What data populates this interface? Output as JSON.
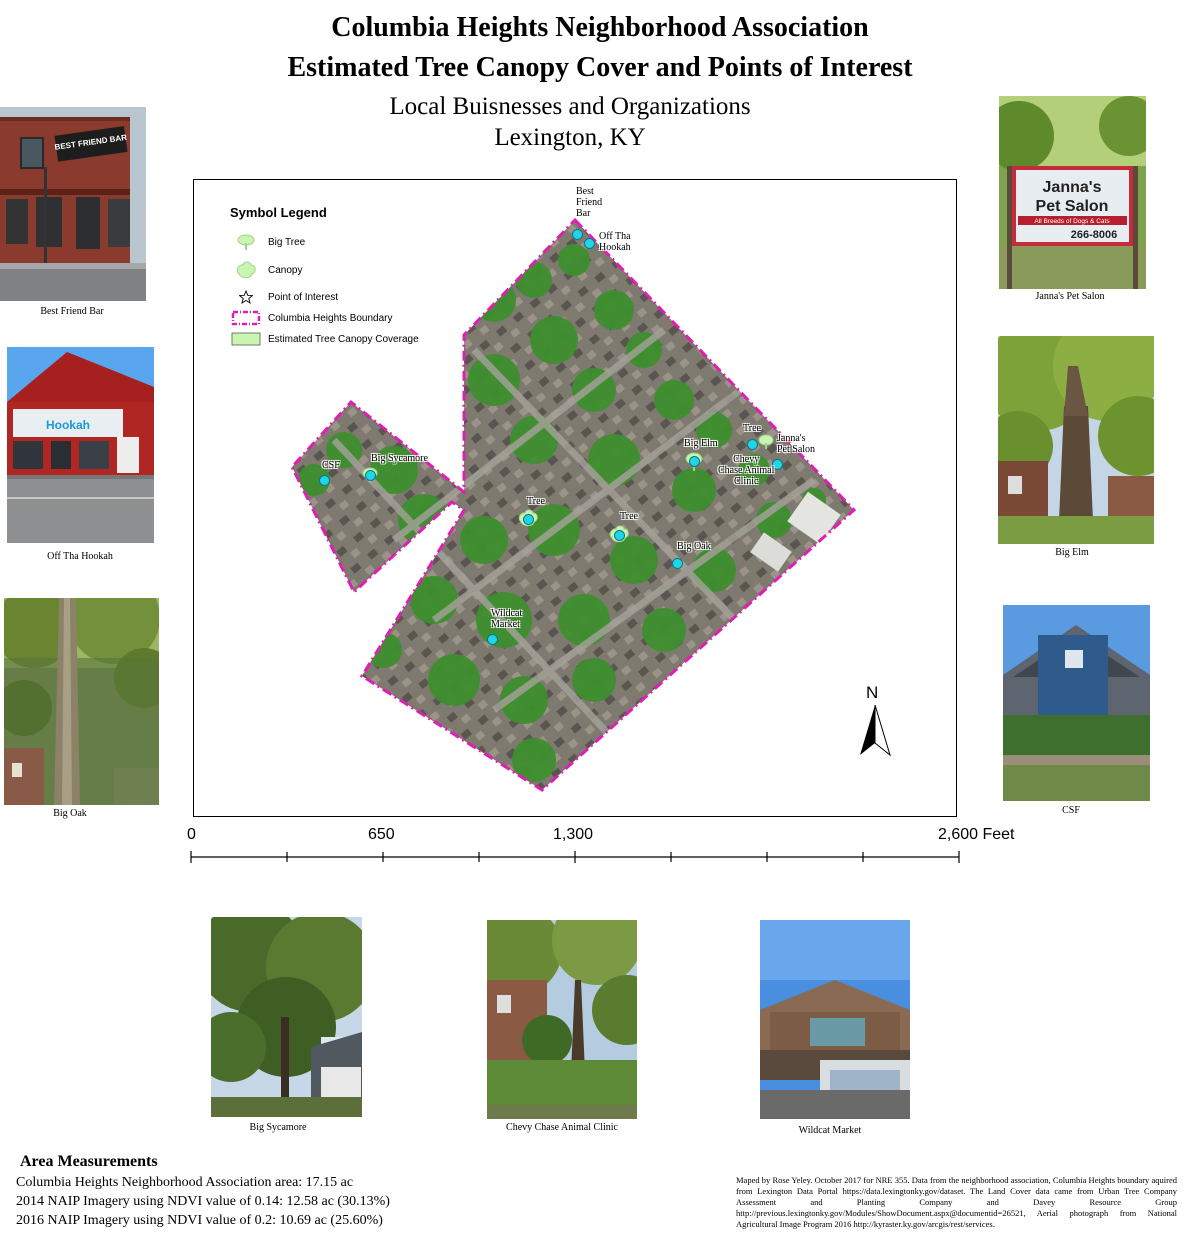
{
  "title": {
    "line1": "Columbia Heights Neighborhood Association",
    "line2": "Estimated Tree Canopy Cover and Points of Interest",
    "sub1": "Local Buisnesses and Organizations",
    "sub2": "Lexington, KY"
  },
  "legend": {
    "title": "Symbol Legend",
    "items": [
      {
        "label": "Big Tree",
        "icon": "big-tree-icon"
      },
      {
        "label": "Canopy",
        "icon": "canopy-icon"
      },
      {
        "label": "Point of Interest",
        "icon": "star-icon"
      },
      {
        "label": "Columbia Heights Boundary",
        "icon": "boundary-swatch"
      },
      {
        "label": "Estimated Tree Canopy Coverage",
        "icon": "canopy-swatch"
      }
    ]
  },
  "colors": {
    "boundary": "#e01eb4",
    "canopy_fill": "#c9f5b0",
    "poi": "#22d4e8",
    "map_green": "#3f8f2f",
    "map_road": "#8a8a86"
  },
  "poi_labels": {
    "best_friend_bar": "Best\nFriend\nBar",
    "off_tha_hookah": "Off Tha\nHookah",
    "tree_top": "Tree",
    "jannas": "Janna's\nPet Salon",
    "big_elm": "Big Elm",
    "chevy_chase": "Chevy\nChase Animal\nClinic",
    "csf": "CSF",
    "big_sycamore": "Big Sycamore",
    "tree_left": "Tree",
    "tree_mid": "Tree",
    "big_oak": "Big Oak",
    "wildcat": "Wildcat\nMarket"
  },
  "north_arrow": "N",
  "scale_bar": {
    "labels": [
      "0",
      "650",
      "1,300",
      "2,600 Feet"
    ]
  },
  "photos": {
    "best_friend_bar": "Best Friend Bar",
    "off_tha_hookah": "Off Tha Hookah",
    "big_oak": "Big Oak",
    "jannas_pet_salon": "Janna's Pet Salon",
    "big_elm": "Big Elm",
    "csf": "CSF",
    "big_sycamore": "Big Sycamore",
    "chevy_chase": "Chevy Chase Animal Clinic",
    "wildcat": "Wildcat Market"
  },
  "photo_text": {
    "bar_sign": "BEST FRIEND BAR",
    "hookah_sign": "Hookah",
    "janna_title1": "Janna's",
    "janna_title2": "Pet Salon",
    "janna_line": "All Breeds of Dogs & Cats",
    "janna_phone": "266-8006"
  },
  "area": {
    "title": "Area Measurements",
    "lines": [
      "Columbia Heights Neighborhood Association area: 17.15 ac",
      "2014 NAIP Imagery using NDVI value of 0.14: 12.58 ac (30.13%)",
      "2016 NAIP Imagery using NDVI value of 0.2: 10.69 ac (25.60%)"
    ]
  },
  "credit": "Maped by Rose Yeley. October 2017 for NRE 355. Data from the neighborhood association, Columbia Heights boundary aquired from Lexington Data Portal https://data.lexingtonky.gov/dataset. The Land Cover data came from Urban Tree Company Assessment and Planting Company and Davey Resource Group http://previous.lexingtonky.gov/Modules/ShowDocument.aspx@documentid=26521, Aerial photograph from National Agricultural Image Program 2016 http://kyraster.ky.gov/arcgis/rest/services."
}
